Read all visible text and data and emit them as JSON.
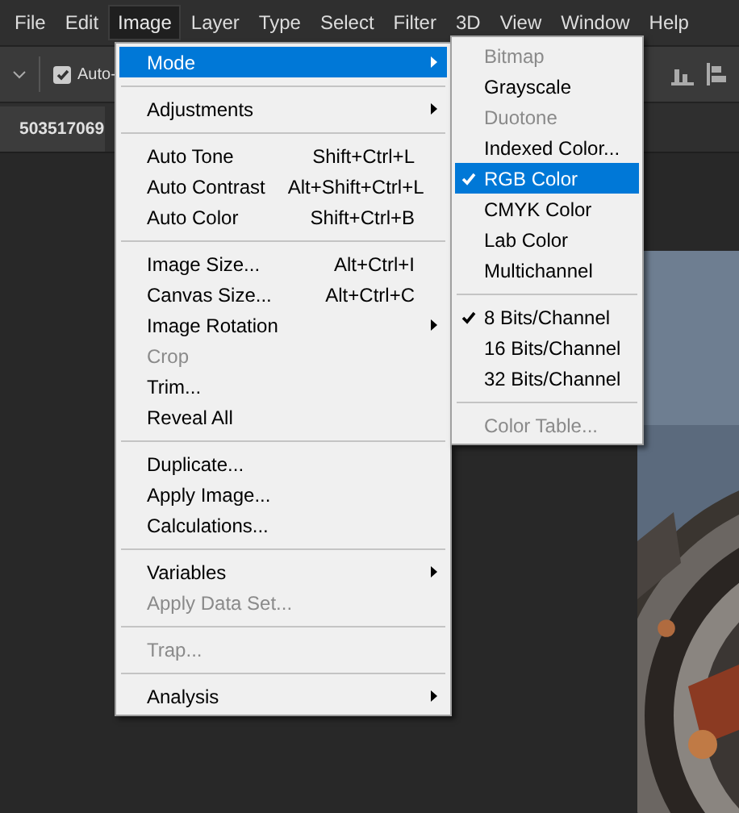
{
  "menubar": [
    {
      "label": "File",
      "selected": false
    },
    {
      "label": "Edit",
      "selected": false
    },
    {
      "label": "Image",
      "selected": true
    },
    {
      "label": "Layer",
      "selected": false
    },
    {
      "label": "Type",
      "selected": false
    },
    {
      "label": "Select",
      "selected": false
    },
    {
      "label": "Filter",
      "selected": false
    },
    {
      "label": "3D",
      "selected": false
    },
    {
      "label": "View",
      "selected": false
    },
    {
      "label": "Window",
      "selected": false
    },
    {
      "label": "Help",
      "selected": false
    }
  ],
  "options_bar": {
    "auto_select": {
      "label": "Auto-",
      "checked": true
    }
  },
  "document_tab": {
    "title": "503517069"
  },
  "image_menu": {
    "items": [
      {
        "kind": "item",
        "label": "Mode",
        "submenu": true,
        "highlighted": true,
        "disabled": false
      },
      {
        "kind": "separator"
      },
      {
        "kind": "item",
        "label": "Adjustments",
        "submenu": true,
        "highlighted": false,
        "disabled": false
      },
      {
        "kind": "separator"
      },
      {
        "kind": "item",
        "label": "Auto Tone",
        "shortcut": "Shift+Ctrl+L",
        "highlighted": false,
        "disabled": false
      },
      {
        "kind": "item",
        "label": "Auto Contrast",
        "shortcut": "Alt+Shift+Ctrl+L",
        "highlighted": false,
        "disabled": false
      },
      {
        "kind": "item",
        "label": "Auto Color",
        "shortcut": "Shift+Ctrl+B",
        "highlighted": false,
        "disabled": false
      },
      {
        "kind": "separator"
      },
      {
        "kind": "item",
        "label": "Image Size...",
        "shortcut": "Alt+Ctrl+I",
        "highlighted": false,
        "disabled": false
      },
      {
        "kind": "item",
        "label": "Canvas Size...",
        "shortcut": "Alt+Ctrl+C",
        "highlighted": false,
        "disabled": false
      },
      {
        "kind": "item",
        "label": "Image Rotation",
        "submenu": true,
        "highlighted": false,
        "disabled": false
      },
      {
        "kind": "item",
        "label": "Crop",
        "highlighted": false,
        "disabled": true
      },
      {
        "kind": "item",
        "label": "Trim...",
        "highlighted": false,
        "disabled": false
      },
      {
        "kind": "item",
        "label": "Reveal All",
        "highlighted": false,
        "disabled": false
      },
      {
        "kind": "separator"
      },
      {
        "kind": "item",
        "label": "Duplicate...",
        "highlighted": false,
        "disabled": false
      },
      {
        "kind": "item",
        "label": "Apply Image...",
        "highlighted": false,
        "disabled": false
      },
      {
        "kind": "item",
        "label": "Calculations...",
        "highlighted": false,
        "disabled": false
      },
      {
        "kind": "separator"
      },
      {
        "kind": "item",
        "label": "Variables",
        "submenu": true,
        "highlighted": false,
        "disabled": false
      },
      {
        "kind": "item",
        "label": "Apply Data Set...",
        "highlighted": false,
        "disabled": true
      },
      {
        "kind": "separator"
      },
      {
        "kind": "item",
        "label": "Trap...",
        "highlighted": false,
        "disabled": true
      },
      {
        "kind": "separator"
      },
      {
        "kind": "item",
        "label": "Analysis",
        "submenu": true,
        "highlighted": false,
        "disabled": false
      }
    ]
  },
  "mode_submenu": {
    "items": [
      {
        "kind": "item",
        "label": "Bitmap",
        "checked": false,
        "highlighted": false,
        "disabled": true
      },
      {
        "kind": "item",
        "label": "Grayscale",
        "checked": false,
        "highlighted": false,
        "disabled": false
      },
      {
        "kind": "item",
        "label": "Duotone",
        "checked": false,
        "highlighted": false,
        "disabled": true
      },
      {
        "kind": "item",
        "label": "Indexed Color...",
        "checked": false,
        "highlighted": false,
        "disabled": false
      },
      {
        "kind": "item",
        "label": "RGB Color",
        "checked": true,
        "highlighted": true,
        "disabled": false
      },
      {
        "kind": "item",
        "label": "CMYK Color",
        "checked": false,
        "highlighted": false,
        "disabled": false
      },
      {
        "kind": "item",
        "label": "Lab Color",
        "checked": false,
        "highlighted": false,
        "disabled": false
      },
      {
        "kind": "item",
        "label": "Multichannel",
        "checked": false,
        "highlighted": false,
        "disabled": false
      },
      {
        "kind": "separator"
      },
      {
        "kind": "item",
        "label": "8 Bits/Channel",
        "checked": true,
        "highlighted": false,
        "disabled": false
      },
      {
        "kind": "item",
        "label": "16 Bits/Channel",
        "checked": false,
        "highlighted": false,
        "disabled": false
      },
      {
        "kind": "item",
        "label": "32 Bits/Channel",
        "checked": false,
        "highlighted": false,
        "disabled": false
      },
      {
        "kind": "separator"
      },
      {
        "kind": "item",
        "label": "Color Table...",
        "checked": false,
        "highlighted": false,
        "disabled": true
      }
    ]
  }
}
